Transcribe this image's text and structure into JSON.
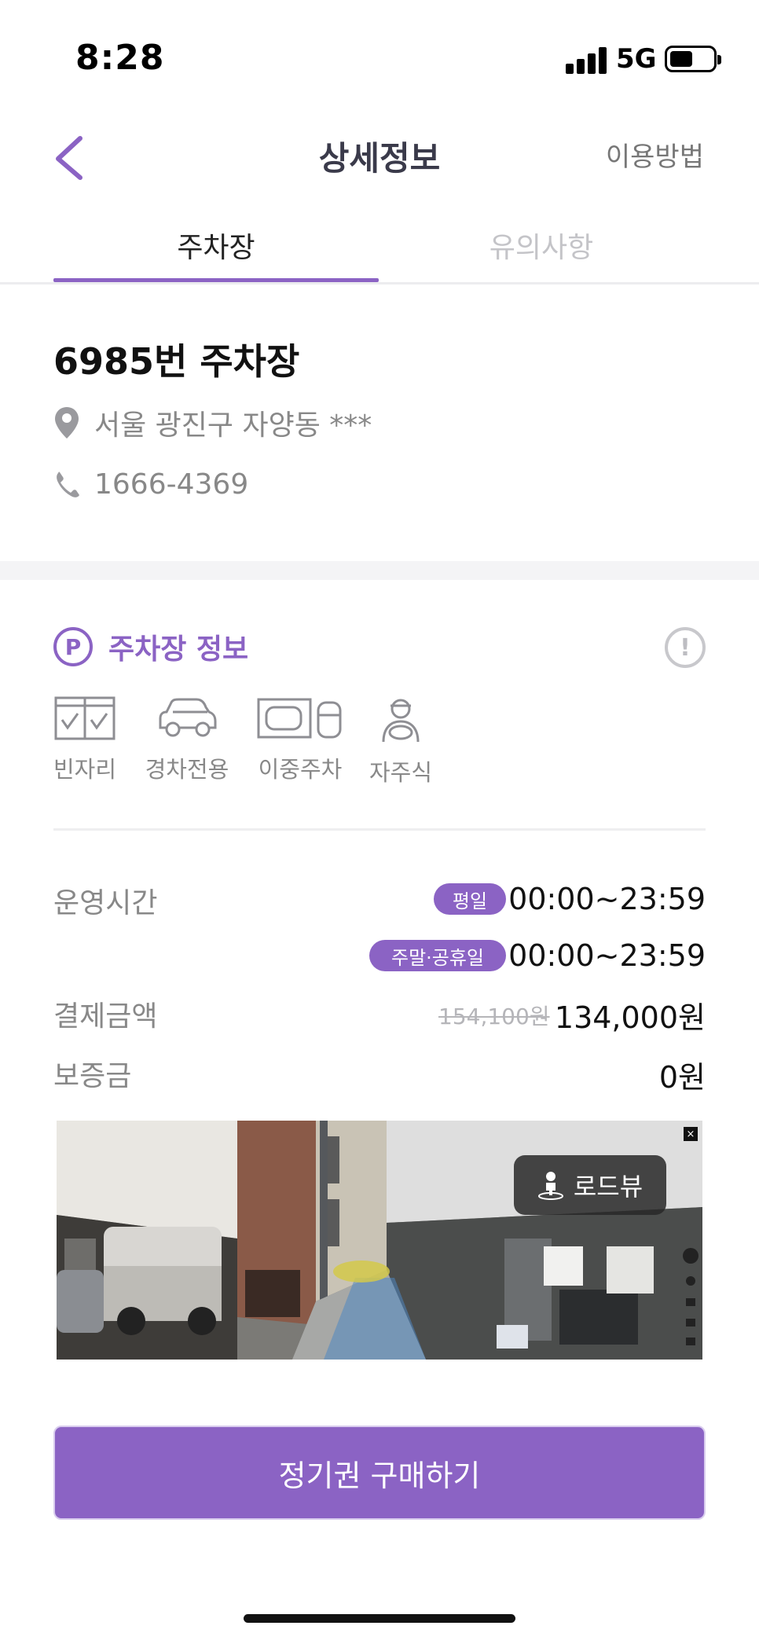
{
  "status_bar": {
    "time": "8:28",
    "network": "5G"
  },
  "header": {
    "title": "상세정보",
    "help_link": "이용방법",
    "back_icon": "chevron-left-icon"
  },
  "tabs": [
    {
      "label": "주차장",
      "active": true
    },
    {
      "label": "유의사항",
      "active": false
    }
  ],
  "lot": {
    "name": "6985번 주차장",
    "address": "서울 광진구 자양동 ***",
    "phone": "1666-4369"
  },
  "info": {
    "title": "주차장 정보",
    "badge_letter": "P",
    "alert_symbol": "!",
    "features": [
      {
        "label": "빈자리",
        "icon": "checkbox-grid-icon"
      },
      {
        "label": "경차전용",
        "icon": "compact-car-icon"
      },
      {
        "label": "이중주차",
        "icon": "double-parking-icon"
      },
      {
        "label": "자주식",
        "icon": "driver-icon"
      }
    ],
    "hours_label": "운영시간",
    "hours": [
      {
        "day_type": "평일",
        "time": "00:00~23:59"
      },
      {
        "day_type": "주말·공휴일",
        "time": "00:00~23:59"
      }
    ],
    "payment_label": "결제금액",
    "original_price": "154,100원",
    "price": "134,000원",
    "deposit_label": "보증금",
    "deposit": "0원"
  },
  "roadview": {
    "button_label": "로드뷰",
    "close_symbol": "×"
  },
  "purchase_button": "정기권 구매하기",
  "colors": {
    "accent": "#8b63c4",
    "muted_text": "#888888",
    "tab_inactive": "#c4c4c8"
  }
}
